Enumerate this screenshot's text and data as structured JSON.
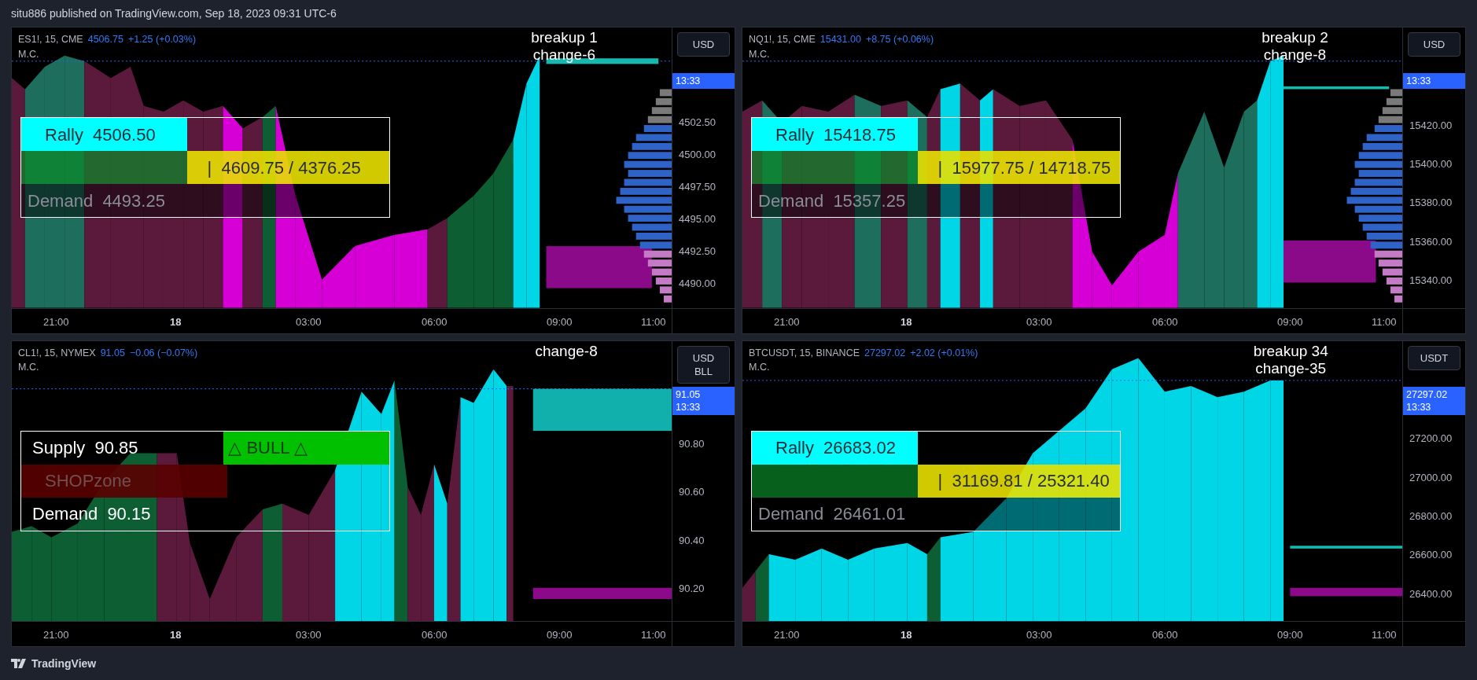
{
  "header": {
    "text": "situ886 published on TradingView.com, Sep 18, 2023 09:31 UTC-6"
  },
  "panels": [
    {
      "symbol": "ES1!, 15, CME",
      "price": "4506.75",
      "change": "+1.25 (+0.03%)",
      "study": "M.C.",
      "currency": [
        "USD"
      ],
      "badge": {
        "time": "13:33"
      },
      "annotation": [
        "breakup 1",
        "change-6"
      ],
      "price_labels": [
        "4502.50",
        "4500.00",
        "4497.50",
        "4495.00",
        "4492.50",
        "4490.00"
      ],
      "time_labels": [
        "21:00",
        "18",
        "03:00",
        "06:00",
        "09:00",
        "11:00"
      ],
      "info_box": {
        "rows": [
          [
            {
              "kind": "rally",
              "text": "Rally  4506.50"
            },
            {
              "kind": "blank"
            }
          ],
          [
            {
              "kind": "filler"
            },
            {
              "kind": "range",
              "text": "|  4609.75 / 4376.25"
            }
          ],
          [
            {
              "kind": "faded",
              "text": "Demand  4493.25"
            }
          ]
        ]
      }
    },
    {
      "symbol": "NQ1!, 15, CME",
      "price": "15431.00",
      "change": "+8.75 (+0.06%)",
      "study": "M.C.",
      "currency": [
        "USD"
      ],
      "badge": {
        "time": "13:33"
      },
      "annotation": [
        "breakup 2",
        "change-8"
      ],
      "price_labels": [
        "15420.00",
        "15400.00",
        "15380.00",
        "15360.00",
        "15340.00"
      ],
      "time_labels": [
        "21:00",
        "18",
        "03:00",
        "06:00",
        "09:00",
        "11:00"
      ],
      "info_box": {
        "rows": [
          [
            {
              "kind": "rally",
              "text": "Rally  15418.75"
            },
            {
              "kind": "blank"
            }
          ],
          [
            {
              "kind": "filler"
            },
            {
              "kind": "range",
              "text": "|  15977.75 / 14718.75"
            }
          ],
          [
            {
              "kind": "faded",
              "text": "Demand  15357.25"
            }
          ]
        ]
      }
    },
    {
      "symbol": "CL1!, 15, NYMEX",
      "price": "91.05",
      "change": "−0.06 (−0.07%)",
      "study": "M.C.",
      "currency": [
        "USD",
        "BLL"
      ],
      "badge": {
        "price": "91.05",
        "time": "13:33"
      },
      "annotation": [
        "change-8"
      ],
      "price_labels": [
        "90.80",
        "90.60",
        "90.40",
        "90.20"
      ],
      "time_labels": [
        "21:00",
        "18",
        "03:00",
        "06:00",
        "09:00",
        "11:00"
      ],
      "info_box": {
        "rows": [
          [
            {
              "kind": "label",
              "text": "Supply  90.85"
            },
            {
              "kind": "bull",
              "text": "△ BULL △"
            }
          ],
          [
            {
              "kind": "zone",
              "text": "SHOPzone"
            }
          ],
          [
            {
              "kind": "label",
              "text": "Demand  90.15"
            }
          ]
        ]
      }
    },
    {
      "symbol": "BTCUSDT, 15, BINANCE",
      "price": "27297.02",
      "change": "+2.02 (+0.01%)",
      "study": "M.C.",
      "currency": [
        "USDT"
      ],
      "badge": {
        "price": "27297.02",
        "time": "13:33"
      },
      "annotation": [
        "breakup 34",
        "change-35"
      ],
      "price_labels": [
        "27200.00",
        "27000.00",
        "26800.00",
        "26600.00",
        "26400.00"
      ],
      "time_labels": [
        "21:00",
        "18",
        "03:00",
        "06:00",
        "09:00",
        "11:00"
      ],
      "info_box": {
        "rows": [
          [
            {
              "kind": "rally",
              "text": "Rally  26683.02"
            },
            {
              "kind": "blank"
            }
          ],
          [
            {
              "kind": "filler"
            },
            {
              "kind": "range",
              "text": "|  31169.81 / 25321.40"
            }
          ],
          [
            {
              "kind": "faded",
              "text": "Demand  26461.01"
            }
          ]
        ]
      }
    }
  ],
  "footer": {
    "brand": "TradingView"
  }
}
